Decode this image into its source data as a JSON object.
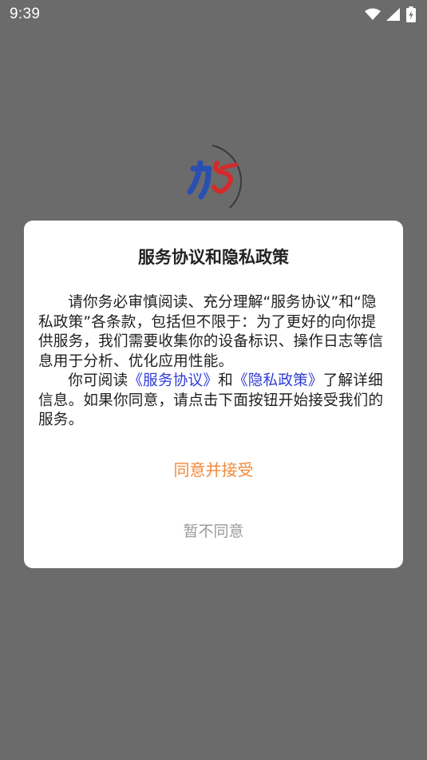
{
  "status_bar": {
    "time": "9:39",
    "icons": [
      "wifi-icon",
      "cellular-signal-icon",
      "battery-charging-icon"
    ]
  },
  "splash": {
    "logo": "app-logo-icon",
    "colors": {
      "blue": "#2a4fb3",
      "red": "#d42a2a"
    }
  },
  "dialog": {
    "title": "服务协议和隐私政策",
    "paragraph1": "请你务必审慎阅读、充分理解“服务协议”和“隐私政策”各条款，包括但不限于：为了更好的向你提供服务，我们需要收集你的设备标识、操作日志等信息用于分析、优化应用性能。",
    "paragraph2_prefix": "你可阅读",
    "service_link": "《服务协议》",
    "and_text": "和",
    "privacy_link": "《隐私政策》",
    "paragraph2_suffix": "了解详细信息。如果你同意，请点击下面按钮开始接受我们的服务。",
    "agree_button": "同意并接受",
    "disagree_button": "暂不同意",
    "colors": {
      "agree": "#f08a3c",
      "link": "#2f3bd6",
      "disagree": "#9a9a9a"
    }
  }
}
